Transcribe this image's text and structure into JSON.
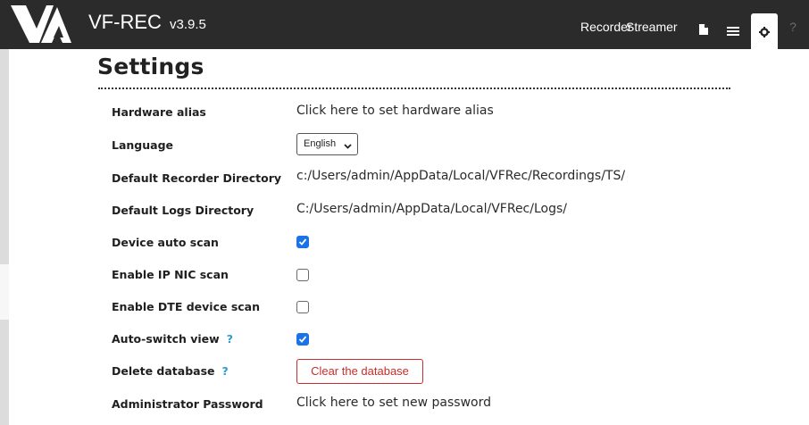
{
  "header": {
    "app_name": "VF-REC",
    "version": "v3.9.5",
    "nav": {
      "recorder": "Recorder",
      "streamer": "Streamer",
      "help": "?"
    },
    "icons": [
      "document-icon",
      "list-icon",
      "gear-icon"
    ]
  },
  "page": {
    "title": "Settings"
  },
  "settings": {
    "hardware_alias": {
      "label": "Hardware alias",
      "value": "Click here to set hardware alias"
    },
    "language": {
      "label": "Language",
      "selected": "English"
    },
    "recorder_dir": {
      "label": "Default Recorder Directory",
      "value": "c:/Users/admin/AppData/Local/VFRec/Recordings/TS/"
    },
    "logs_dir": {
      "label": "Default Logs Directory",
      "value": "C:/Users/admin/AppData/Local/VFRec/Logs/"
    },
    "device_auto_scan": {
      "label": "Device auto scan",
      "checked": true
    },
    "ip_nic_scan": {
      "label": "Enable IP NIC scan",
      "checked": false
    },
    "dte_scan": {
      "label": "Enable DTE device scan",
      "checked": false
    },
    "auto_switch": {
      "label": "Auto-switch view",
      "help": "?",
      "checked": true
    },
    "delete_db": {
      "label": "Delete database",
      "help": "?",
      "button": "Clear the database"
    },
    "admin_password": {
      "label": "Administrator Password",
      "value": "Click here to set new password"
    }
  },
  "colors": {
    "header_bg": "#2b2b2b",
    "accent_check": "#1a73e8",
    "help_mark": "#2f9bd1",
    "danger": "#cc2b2b"
  }
}
